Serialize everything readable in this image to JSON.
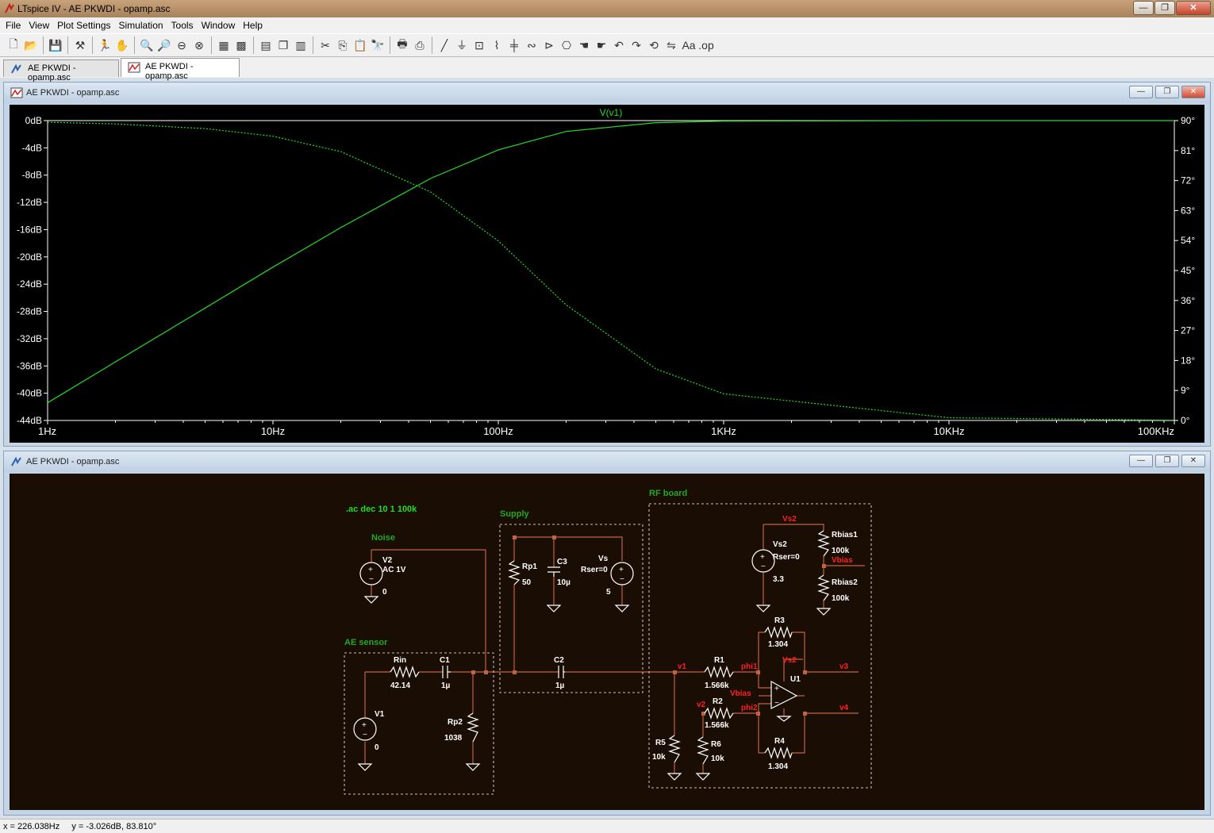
{
  "app": {
    "title": "LTspice IV - AE PKWDI - opamp.asc"
  },
  "window_buttons": {
    "minimize": "—",
    "restore": "❐",
    "close": "✕"
  },
  "menu": [
    "File",
    "View",
    "Plot Settings",
    "Simulation",
    "Tools",
    "Window",
    "Help"
  ],
  "tabs": [
    {
      "label": "AE PKWDI - opamp.asc",
      "active": false
    },
    {
      "label": "AE PKWDI - opamp.asc",
      "active": true
    }
  ],
  "plot_window": {
    "title": "AE PKWDI - opamp.asc"
  },
  "schematic_window": {
    "title": "AE PKWDI - opamp.asc"
  },
  "status": {
    "x": "x = 226.038Hz",
    "y": "y = -3.026dB, 83.810°"
  },
  "colors": {
    "plot_bg": "#000000",
    "trace": "#22dd22",
    "schematic_bg": "#1a0d03",
    "wire": "#c0643c",
    "net_label": "#ff2020",
    "comment": "#22aa22",
    "symbol": "#ffffff"
  },
  "chart_data": {
    "type": "line",
    "title": "V(v1)",
    "xscale": "log",
    "xlim": [
      1,
      100000
    ],
    "x_ticks": [
      "1Hz",
      "10Hz",
      "100Hz",
      "1KHz",
      "10KHz",
      "100KHz"
    ],
    "ylim_left": [
      -44,
      0
    ],
    "y_ticks_left": [
      "0dB",
      "-4dB",
      "-8dB",
      "-12dB",
      "-16dB",
      "-20dB",
      "-24dB",
      "-28dB",
      "-32dB",
      "-36dB",
      "-40dB",
      "-44dB"
    ],
    "ylim_right": [
      0,
      90
    ],
    "y_ticks_right": [
      "90°",
      "81°",
      "72°",
      "63°",
      "54°",
      "45°",
      "36°",
      "27°",
      "18°",
      "9°",
      "0°"
    ],
    "series": [
      {
        "name": "V(v1)",
        "style": "solid",
        "axis": "left",
        "x": [
          1,
          2,
          5,
          10,
          20,
          50,
          100,
          200,
          500,
          1000,
          10000,
          100000
        ],
        "y": [
          -41.4,
          -35.4,
          -27.5,
          -21.5,
          -15.7,
          -8.5,
          -4.3,
          -1.6,
          -0.3,
          -0.08,
          0,
          0
        ]
      },
      {
        "name": "V(v1) phase",
        "style": "dotted",
        "axis": "right",
        "x": [
          1,
          2,
          5,
          10,
          20,
          50,
          100,
          200,
          500,
          1000,
          10000,
          100000
        ],
        "y": [
          89.5,
          89.0,
          87.6,
          85.3,
          80.7,
          68.6,
          53.9,
          34.7,
          15.5,
          8.0,
          0.8,
          0.1
        ]
      }
    ]
  },
  "schematic": {
    "directives": {
      "ac": ".ac dec 10 1 100k"
    },
    "groups": {
      "noise": "Noise",
      "supply": "Supply",
      "rf": "RF board",
      "ae": "AE sensor"
    },
    "components": {
      "v2": {
        "name": "V2",
        "value": "AC 1V",
        "dc": "0"
      },
      "rp1": {
        "name": "Rp1",
        "value": "50"
      },
      "c3": {
        "name": "C3",
        "value": "10µ"
      },
      "vs": {
        "name": "Vs",
        "value": "Rser=0",
        "dc": "5"
      },
      "vs2": {
        "name": "Vs2",
        "value": "Rser=0",
        "dc": "3.3"
      },
      "rbias1": {
        "name": "Rbias1",
        "value": "100k"
      },
      "rbias2": {
        "name": "Rbias2",
        "value": "100k"
      },
      "rin": {
        "name": "Rin",
        "value": "42.14"
      },
      "c1": {
        "name": "C1",
        "value": "1µ"
      },
      "c2": {
        "name": "C2",
        "value": "1µ"
      },
      "v1": {
        "name": "V1",
        "dc": "0"
      },
      "rp2": {
        "name": "Rp2",
        "value": "1038"
      },
      "r1": {
        "name": "R1",
        "value": "1.566k"
      },
      "r2": {
        "name": "R2",
        "value": "1.566k"
      },
      "r3": {
        "name": "R3",
        "value": "1.304"
      },
      "r4": {
        "name": "R4",
        "value": "1.304"
      },
      "r5": {
        "name": "R5",
        "value": "10k"
      },
      "r6": {
        "name": "R6",
        "value": "10k"
      },
      "u1": {
        "name": "U1"
      }
    },
    "nets": {
      "vs2": "Vs2",
      "vbias": "Vbias",
      "v1": "v1",
      "phi1": "phi1",
      "phi2": "phi2",
      "v2": "v2",
      "v3": "v3",
      "v4": "v4",
      "vs2_u": "Vs2",
      "vbias_u": "Vbias"
    }
  }
}
